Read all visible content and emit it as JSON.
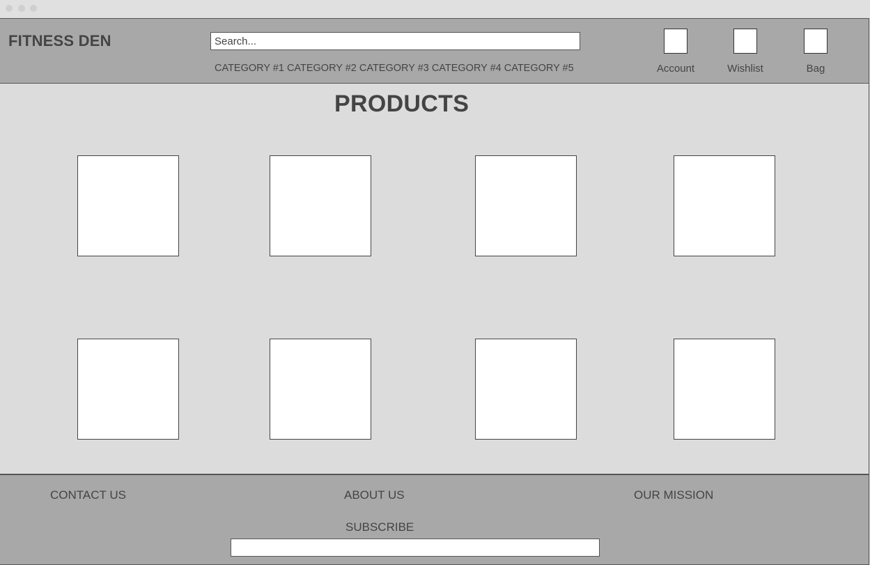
{
  "header": {
    "brand": "FITNESS DEN",
    "search_placeholder": "Search...",
    "categories": [
      "CATEGORY #1",
      "CATEGORY #2",
      "CATEGORY #3",
      "CATEGORY #4",
      "CATEGORY #5"
    ],
    "account_label": "Account",
    "wishlist_label": "Wishlist",
    "bag_label": "Bag"
  },
  "main": {
    "title": "PRODUCTS",
    "product_count": 8
  },
  "footer": {
    "contact": "CONTACT US",
    "about": "ABOUT US",
    "mission": "OUR MISSION",
    "subscribe": "SUBSCRIBE"
  }
}
